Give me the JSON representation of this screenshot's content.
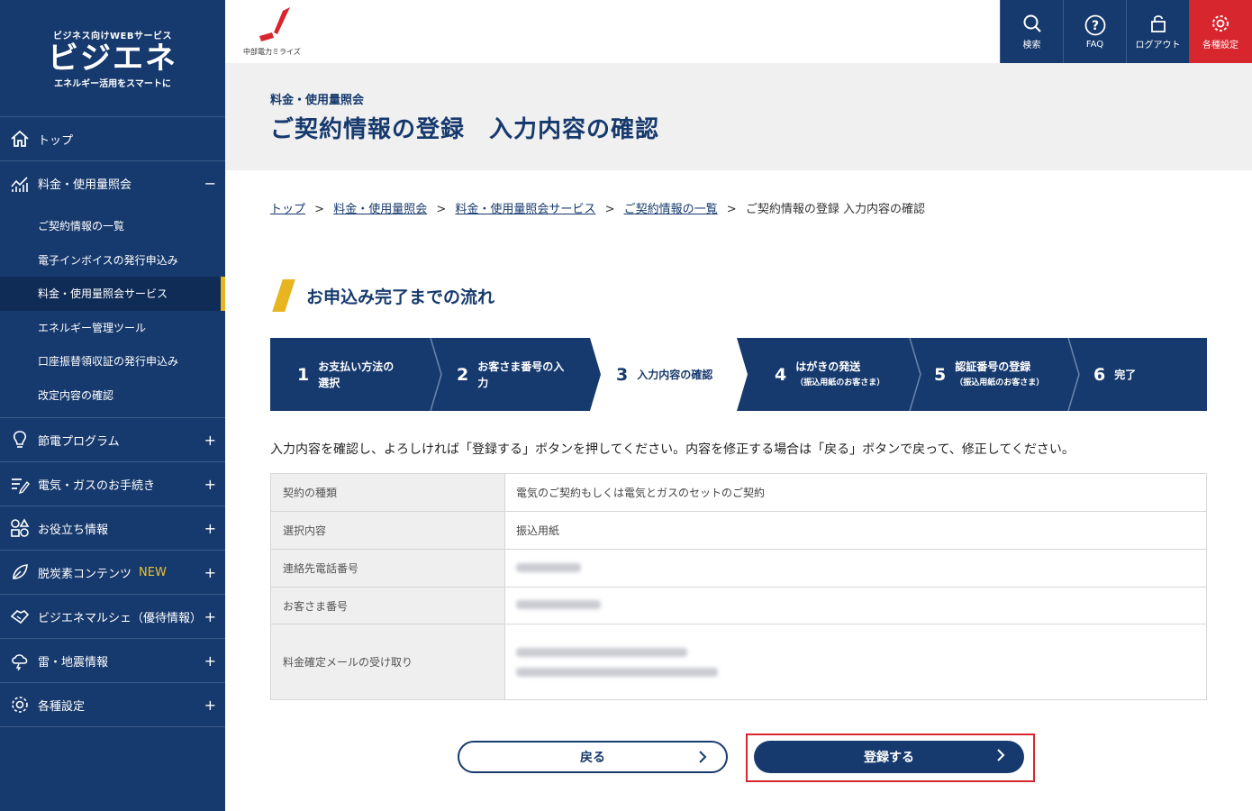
{
  "brand": {
    "sub": "ビジネス向けWEBサービス",
    "main": "ビジエネ",
    "tagline": "エネルギー活用をスマートに"
  },
  "logo": {
    "text": "中部電力ミライズ"
  },
  "topnav": [
    {
      "label": "検索",
      "icon": "search-icon"
    },
    {
      "label": "FAQ",
      "icon": "question-icon"
    },
    {
      "label": "ログアウト",
      "icon": "lock-icon"
    },
    {
      "label": "各種設定",
      "icon": "gear-icon"
    }
  ],
  "sidebar": {
    "top": "トップ",
    "billing": {
      "label": "料金・使用量照会",
      "toggle": "−",
      "items": [
        "ご契約情報の一覧",
        "電子インボイスの発行申込み",
        "料金・使用量照会サービス",
        "エネルギー管理ツール",
        "口座振替領収証の発行申込み",
        "改定内容の確認"
      ]
    },
    "sections": [
      {
        "label": "節電プログラム",
        "toggle": "+"
      },
      {
        "label": "電気・ガスのお手続き",
        "toggle": "+"
      },
      {
        "label": "お役立ち情報",
        "toggle": "+"
      },
      {
        "label": "脱炭素コンテンツ",
        "badge": "NEW",
        "toggle": "+"
      },
      {
        "label": "ビジエネマルシェ（優待情報）",
        "toggle": "+"
      },
      {
        "label": "雷・地震情報",
        "toggle": "+"
      },
      {
        "label": "各種設定",
        "toggle": "+"
      }
    ]
  },
  "header": {
    "category": "料金・使用量照会",
    "title": "ご契約情報の登録　入力内容の確認"
  },
  "breadcrumb": {
    "links": [
      "トップ",
      "料金・使用量照会",
      "料金・使用量照会サービス",
      "ご契約情報の一覧"
    ],
    "current": "ご契約情報の登録 入力内容の確認",
    "sep": ">"
  },
  "flow": {
    "title": "お申込み完了までの流れ",
    "steps": [
      {
        "num": "1",
        "label1": "お支払い方法の",
        "label2": "選択",
        "note": ""
      },
      {
        "num": "2",
        "label1": "お客さま番号の入",
        "label2": "力",
        "note": ""
      },
      {
        "num": "3",
        "label1": "入力内容の確認",
        "label2": "",
        "note": ""
      },
      {
        "num": "4",
        "label1": "はがきの発送",
        "label2": "",
        "note": "（振込用紙のお客さま）"
      },
      {
        "num": "5",
        "label1": "認証番号の登録",
        "label2": "",
        "note": "（振込用紙のお客さま）"
      },
      {
        "num": "6",
        "label1": "完了",
        "label2": "",
        "note": ""
      }
    ],
    "active_step": 3
  },
  "instruction": "入力内容を確認し、よろしければ「登録する」ボタンを押してください。内容を修正する場合は「戻る」ボタンで戻って、修正してください。",
  "table": [
    {
      "key": "契約の種類",
      "value": "電気のご契約もしくは電気とガスのセットのご契約"
    },
    {
      "key": "選択内容",
      "value": "振込用紙"
    },
    {
      "key": "連絡先電話番号",
      "value": ""
    },
    {
      "key": "お客さま番号",
      "value": ""
    },
    {
      "key": "料金確定メールの受け取り",
      "value": ""
    }
  ],
  "buttons": {
    "back": "戻る",
    "submit": "登録する"
  },
  "colors": {
    "navy": "#173a6e",
    "accent": "#e8b420",
    "red": "#d7262e"
  }
}
